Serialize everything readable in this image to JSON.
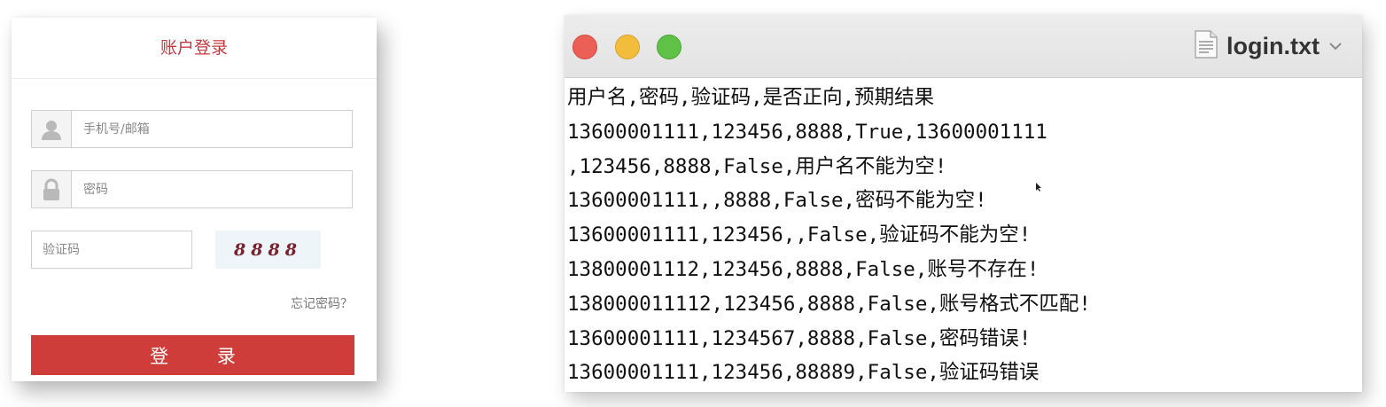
{
  "login_panel": {
    "title": "账户登录",
    "username_placeholder": "手机号/邮箱",
    "password_placeholder": "密码",
    "captcha_placeholder": "验证码",
    "captcha_image_text": "8888",
    "forgot_password": "忘记密码？",
    "login_button": "登 录",
    "colors": {
      "accent": "#cf3d3a",
      "title": "#c9383e"
    }
  },
  "editor": {
    "window_title": "login.txt",
    "lines": [
      "用户名,密码,验证码,是否正向,预期结果",
      "13600001111,123456,8888,True,13600001111",
      ",123456,8888,False,用户名不能为空!",
      "13600001111,,8888,False,密码不能为空!",
      "13600001111,123456,,False,验证码不能为空!",
      "13800001112,123456,8888,False,账号不存在!",
      "138000011112,123456,8888,False,账号格式不匹配!",
      "13600001111,1234567,8888,False,密码错误!",
      "13600001111,123456,88889,False,验证码错误"
    ]
  }
}
